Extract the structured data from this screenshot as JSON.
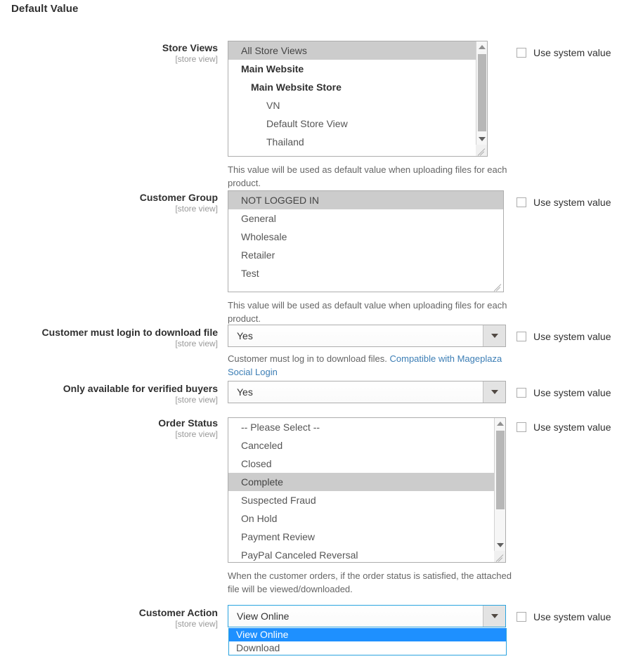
{
  "section": {
    "title": "Default Value"
  },
  "common": {
    "scope": "[store view]",
    "use_system_value": "Use system value"
  },
  "fields": {
    "store_views": {
      "label": "Store Views",
      "scope": "[store view]",
      "note": "This value will be used as default value when uploading files for each product.",
      "options": [
        {
          "label": "All Store Views",
          "level": 0,
          "selected": true
        },
        {
          "label": "Main Website",
          "level": 1,
          "selected": false
        },
        {
          "label": "Main Website Store",
          "level": 2,
          "selected": false
        },
        {
          "label": "VN",
          "level": 3,
          "selected": false
        },
        {
          "label": "Default Store View",
          "level": 3,
          "selected": false
        },
        {
          "label": "Thailand",
          "level": 3,
          "selected": false
        }
      ]
    },
    "customer_group": {
      "label": "Customer Group",
      "scope": "[store view]",
      "note": "This value will be used as default value when uploading files for each product.",
      "options": [
        {
          "label": "NOT LOGGED IN",
          "selected": true
        },
        {
          "label": "General",
          "selected": false
        },
        {
          "label": "Wholesale",
          "selected": false
        },
        {
          "label": "Retailer",
          "selected": false
        },
        {
          "label": "Test",
          "selected": false
        }
      ]
    },
    "customer_must_login": {
      "label": "Customer must login to download file",
      "scope": "[store view]",
      "value": "Yes",
      "note_text": "Customer must log in to download files. ",
      "note_link": "Compatible with Mageplaza Social Login"
    },
    "verified_buyers": {
      "label": "Only available for verified buyers",
      "scope": "[store view]",
      "value": "Yes"
    },
    "order_status": {
      "label": "Order Status",
      "scope": "[store view]",
      "note": "When the customer orders, if the order status is satisfied, the attached file will be viewed/downloaded.",
      "options": [
        {
          "label": "-- Please Select --",
          "selected": false
        },
        {
          "label": "Canceled",
          "selected": false
        },
        {
          "label": "Closed",
          "selected": false
        },
        {
          "label": "Complete",
          "selected": true
        },
        {
          "label": "Suspected Fraud",
          "selected": false
        },
        {
          "label": "On Hold",
          "selected": false
        },
        {
          "label": "Payment Review",
          "selected": false
        },
        {
          "label": "PayPal Canceled Reversal",
          "selected": false
        }
      ]
    },
    "customer_action": {
      "label": "Customer Action",
      "scope": "[store view]",
      "value": "View Online",
      "open": true,
      "options": [
        {
          "label": "View Online",
          "active": true
        },
        {
          "label": "Download",
          "active": false
        }
      ]
    }
  },
  "colors": {
    "accent_blue": "#1e90ff",
    "link_blue": "#3c7eb5",
    "selected_gray": "#cccccc",
    "border_gray": "#adadad",
    "text": "#303030"
  },
  "icons": {
    "scroll_up": "triangle-up-icon",
    "scroll_down": "triangle-down-icon",
    "select_caret": "chevron-down-icon",
    "resize_grip": "resize-grip-icon"
  }
}
